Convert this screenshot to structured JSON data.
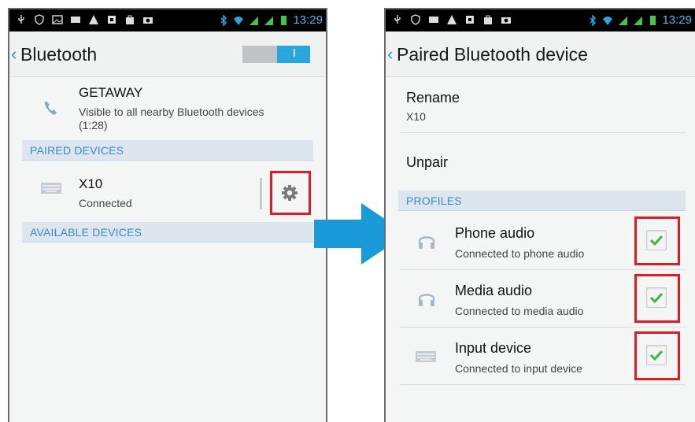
{
  "left_screen": {
    "status_bar": {
      "time": "13:29"
    },
    "header": {
      "title": "Bluetooth",
      "toggle_label": "I"
    },
    "device": {
      "name": "GETAWAY",
      "description": "Visible to all nearby Bluetooth devices",
      "timer": "(1:28)"
    },
    "paired_header": "PAIRED DEVICES",
    "paired_device": {
      "name": "X10",
      "status": "Connected"
    },
    "available_header": "AVAILABLE DEVICES"
  },
  "right_screen": {
    "status_bar": {
      "time": "13:29"
    },
    "header": {
      "title": "Paired Bluetooth device"
    },
    "rename": {
      "label": "Rename",
      "value": "X10"
    },
    "unpair": {
      "label": "Unpair"
    },
    "profiles_header": "PROFILES",
    "profiles": [
      {
        "title": "Phone audio",
        "subtitle": "Connected to phone audio",
        "checked": true
      },
      {
        "title": "Media audio",
        "subtitle": "Connected to media audio",
        "checked": true
      },
      {
        "title": "Input device",
        "subtitle": "Connected to input device",
        "checked": true
      }
    ]
  },
  "colors": {
    "accent": "#2ba5de",
    "highlight": "#e21b23",
    "arrow": "#1a9ad8",
    "check": "#3bb54a"
  }
}
